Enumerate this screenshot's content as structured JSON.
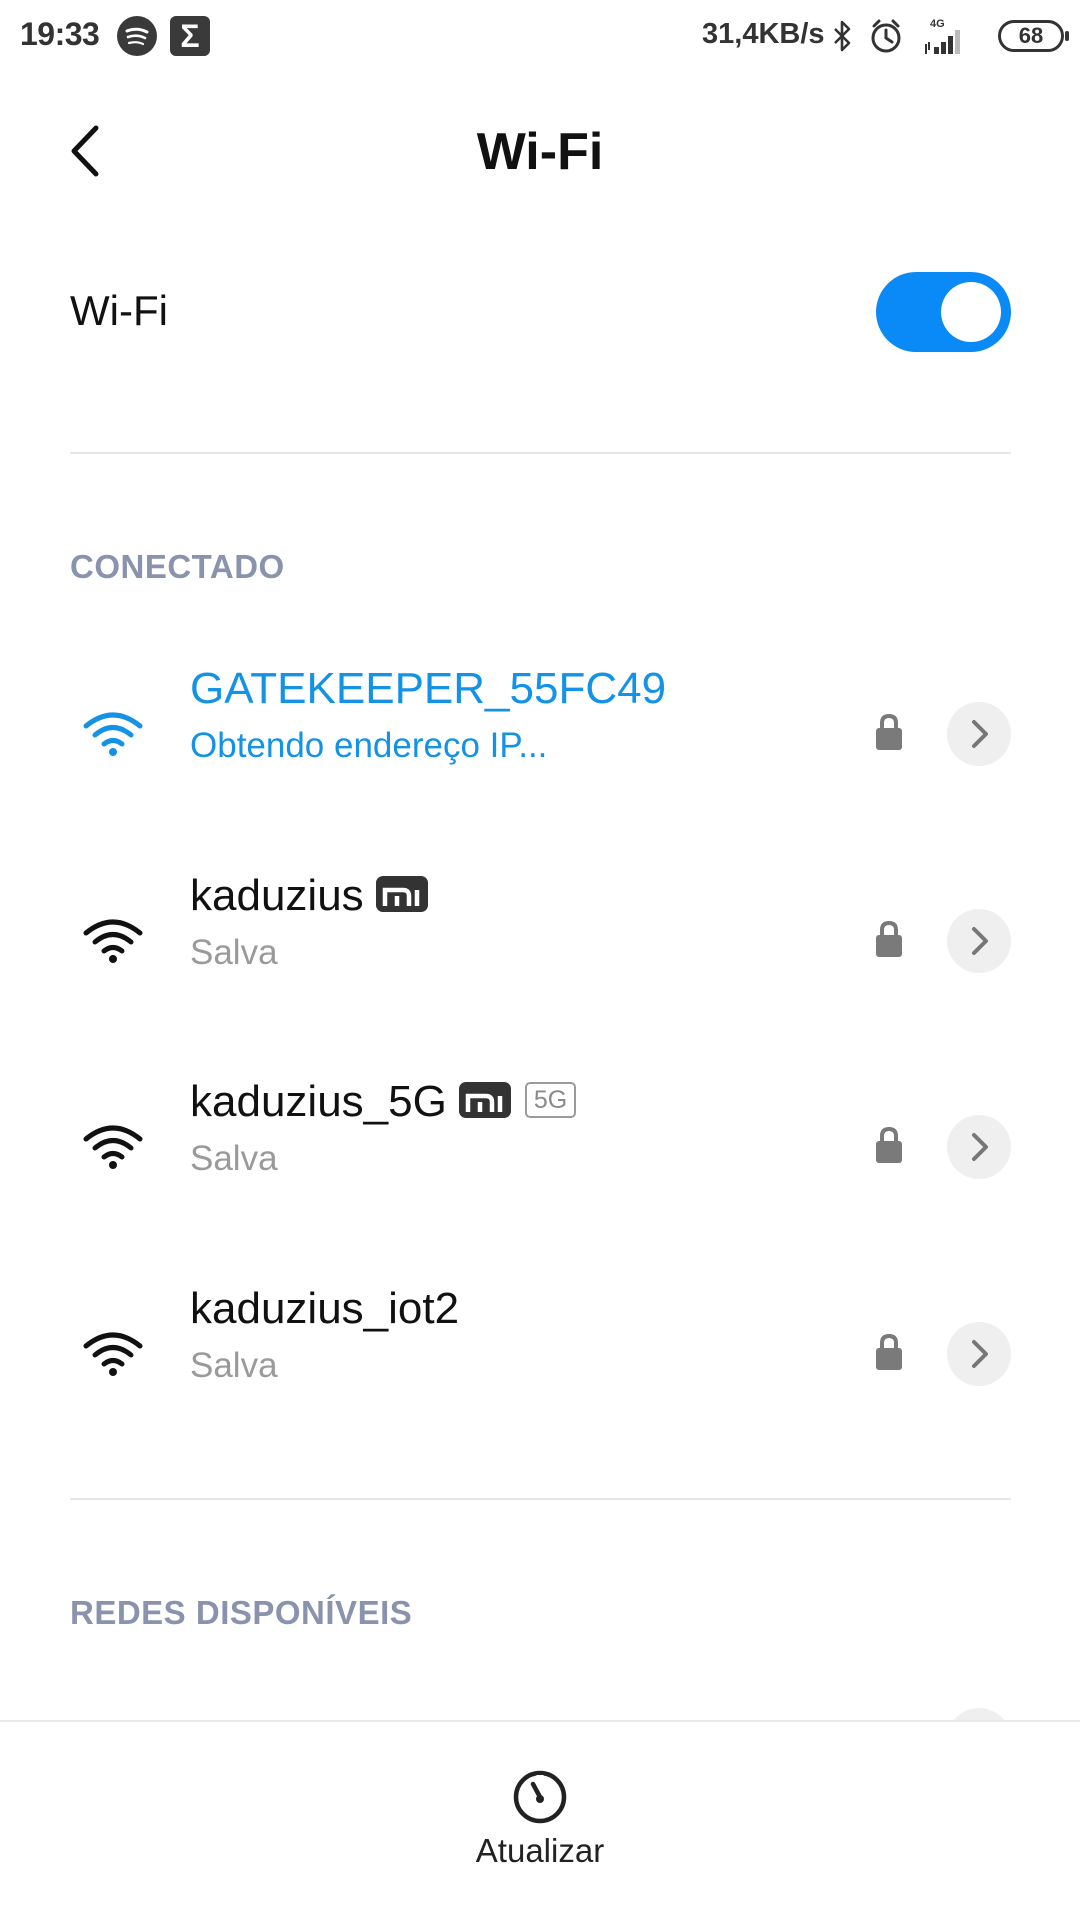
{
  "status_bar": {
    "time": "19:33",
    "net_speed": "31,4KB/s",
    "network_type": "4G",
    "battery": "68",
    "icons": [
      "spotify-icon",
      "sigma-icon",
      "bluetooth-icon",
      "alarm-icon",
      "signal-icon",
      "battery-icon"
    ]
  },
  "header": {
    "title": "Wi-Fi"
  },
  "wifi_toggle": {
    "label": "Wi-Fi",
    "enabled": true,
    "accent_color": "#0a8af6"
  },
  "sections": {
    "connected_header": "CONECTADO",
    "available_header": "REDES DISPONÍVEIS"
  },
  "networks": [
    {
      "name": "GATEKEEPER_55FC49",
      "status": "Obtendo endereço IP...",
      "active": true,
      "secured": true,
      "mi_badge": false,
      "band_badge": ""
    },
    {
      "name": "kaduzius",
      "status": "Salva",
      "active": false,
      "secured": true,
      "mi_badge": true,
      "band_badge": ""
    },
    {
      "name": "kaduzius_5G",
      "status": "Salva",
      "active": false,
      "secured": true,
      "mi_badge": true,
      "band_badge": "5G"
    },
    {
      "name": "kaduzius_iot2",
      "status": "Salva",
      "active": false,
      "secured": true,
      "mi_badge": false,
      "band_badge": ""
    }
  ],
  "bottom": {
    "refresh_label": "Atualizar"
  },
  "colors": {
    "active_text": "#1493e6",
    "section_header": "#8a93ad",
    "secondary_text": "#9a9a9a"
  }
}
